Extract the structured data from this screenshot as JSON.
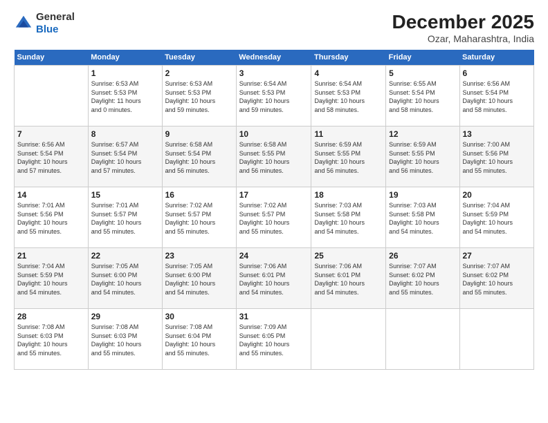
{
  "header": {
    "logo_line1": "General",
    "logo_line2": "Blue",
    "title": "December 2025",
    "subtitle": "Ozar, Maharashtra, India"
  },
  "days_of_week": [
    "Sunday",
    "Monday",
    "Tuesday",
    "Wednesday",
    "Thursday",
    "Friday",
    "Saturday"
  ],
  "weeks": [
    [
      {
        "day": "",
        "info": ""
      },
      {
        "day": "1",
        "info": "Sunrise: 6:53 AM\nSunset: 5:53 PM\nDaylight: 11 hours\nand 0 minutes."
      },
      {
        "day": "2",
        "info": "Sunrise: 6:53 AM\nSunset: 5:53 PM\nDaylight: 10 hours\nand 59 minutes."
      },
      {
        "day": "3",
        "info": "Sunrise: 6:54 AM\nSunset: 5:53 PM\nDaylight: 10 hours\nand 59 minutes."
      },
      {
        "day": "4",
        "info": "Sunrise: 6:54 AM\nSunset: 5:53 PM\nDaylight: 10 hours\nand 58 minutes."
      },
      {
        "day": "5",
        "info": "Sunrise: 6:55 AM\nSunset: 5:54 PM\nDaylight: 10 hours\nand 58 minutes."
      },
      {
        "day": "6",
        "info": "Sunrise: 6:56 AM\nSunset: 5:54 PM\nDaylight: 10 hours\nand 58 minutes."
      }
    ],
    [
      {
        "day": "7",
        "info": "Sunrise: 6:56 AM\nSunset: 5:54 PM\nDaylight: 10 hours\nand 57 minutes."
      },
      {
        "day": "8",
        "info": "Sunrise: 6:57 AM\nSunset: 5:54 PM\nDaylight: 10 hours\nand 57 minutes."
      },
      {
        "day": "9",
        "info": "Sunrise: 6:58 AM\nSunset: 5:54 PM\nDaylight: 10 hours\nand 56 minutes."
      },
      {
        "day": "10",
        "info": "Sunrise: 6:58 AM\nSunset: 5:55 PM\nDaylight: 10 hours\nand 56 minutes."
      },
      {
        "day": "11",
        "info": "Sunrise: 6:59 AM\nSunset: 5:55 PM\nDaylight: 10 hours\nand 56 minutes."
      },
      {
        "day": "12",
        "info": "Sunrise: 6:59 AM\nSunset: 5:55 PM\nDaylight: 10 hours\nand 56 minutes."
      },
      {
        "day": "13",
        "info": "Sunrise: 7:00 AM\nSunset: 5:56 PM\nDaylight: 10 hours\nand 55 minutes."
      }
    ],
    [
      {
        "day": "14",
        "info": "Sunrise: 7:01 AM\nSunset: 5:56 PM\nDaylight: 10 hours\nand 55 minutes."
      },
      {
        "day": "15",
        "info": "Sunrise: 7:01 AM\nSunset: 5:57 PM\nDaylight: 10 hours\nand 55 minutes."
      },
      {
        "day": "16",
        "info": "Sunrise: 7:02 AM\nSunset: 5:57 PM\nDaylight: 10 hours\nand 55 minutes."
      },
      {
        "day": "17",
        "info": "Sunrise: 7:02 AM\nSunset: 5:57 PM\nDaylight: 10 hours\nand 55 minutes."
      },
      {
        "day": "18",
        "info": "Sunrise: 7:03 AM\nSunset: 5:58 PM\nDaylight: 10 hours\nand 54 minutes."
      },
      {
        "day": "19",
        "info": "Sunrise: 7:03 AM\nSunset: 5:58 PM\nDaylight: 10 hours\nand 54 minutes."
      },
      {
        "day": "20",
        "info": "Sunrise: 7:04 AM\nSunset: 5:59 PM\nDaylight: 10 hours\nand 54 minutes."
      }
    ],
    [
      {
        "day": "21",
        "info": "Sunrise: 7:04 AM\nSunset: 5:59 PM\nDaylight: 10 hours\nand 54 minutes."
      },
      {
        "day": "22",
        "info": "Sunrise: 7:05 AM\nSunset: 6:00 PM\nDaylight: 10 hours\nand 54 minutes."
      },
      {
        "day": "23",
        "info": "Sunrise: 7:05 AM\nSunset: 6:00 PM\nDaylight: 10 hours\nand 54 minutes."
      },
      {
        "day": "24",
        "info": "Sunrise: 7:06 AM\nSunset: 6:01 PM\nDaylight: 10 hours\nand 54 minutes."
      },
      {
        "day": "25",
        "info": "Sunrise: 7:06 AM\nSunset: 6:01 PM\nDaylight: 10 hours\nand 54 minutes."
      },
      {
        "day": "26",
        "info": "Sunrise: 7:07 AM\nSunset: 6:02 PM\nDaylight: 10 hours\nand 55 minutes."
      },
      {
        "day": "27",
        "info": "Sunrise: 7:07 AM\nSunset: 6:02 PM\nDaylight: 10 hours\nand 55 minutes."
      }
    ],
    [
      {
        "day": "28",
        "info": "Sunrise: 7:08 AM\nSunset: 6:03 PM\nDaylight: 10 hours\nand 55 minutes."
      },
      {
        "day": "29",
        "info": "Sunrise: 7:08 AM\nSunset: 6:03 PM\nDaylight: 10 hours\nand 55 minutes."
      },
      {
        "day": "30",
        "info": "Sunrise: 7:08 AM\nSunset: 6:04 PM\nDaylight: 10 hours\nand 55 minutes."
      },
      {
        "day": "31",
        "info": "Sunrise: 7:09 AM\nSunset: 6:05 PM\nDaylight: 10 hours\nand 55 minutes."
      },
      {
        "day": "",
        "info": ""
      },
      {
        "day": "",
        "info": ""
      },
      {
        "day": "",
        "info": ""
      }
    ]
  ]
}
